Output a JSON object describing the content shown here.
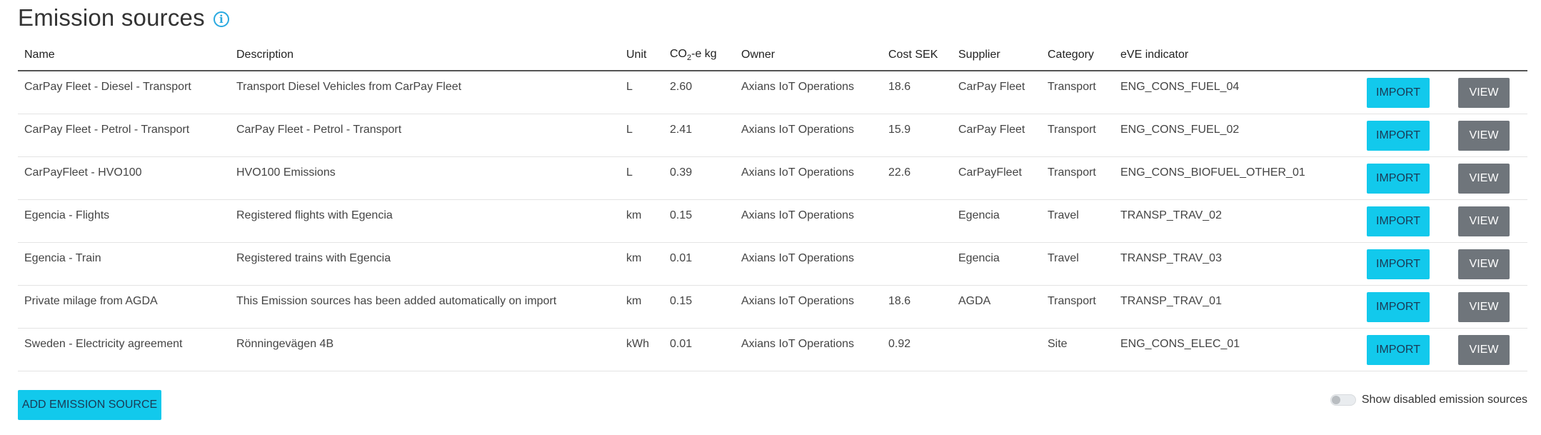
{
  "page": {
    "title": "Emission sources",
    "info_icon": "info-icon"
  },
  "table": {
    "headers": {
      "name": "Name",
      "description": "Description",
      "unit": "Unit",
      "co2_prefix": "CO",
      "co2_sub": "2",
      "co2_suffix": "-e kg",
      "owner": "Owner",
      "cost": "Cost SEK",
      "supplier": "Supplier",
      "category": "Category",
      "indicator": "eVE indicator"
    },
    "rows": [
      {
        "name": "CarPay Fleet - Diesel - Transport",
        "description": "Transport Diesel Vehicles from CarPay Fleet",
        "unit": "L",
        "co2": "2.60",
        "owner": "Axians IoT Operations",
        "cost": "18.6",
        "supplier": "CarPay Fleet",
        "category": "Transport",
        "indicator": "ENG_CONS_FUEL_04",
        "import_label": "IMPORT",
        "view_label": "VIEW"
      },
      {
        "name": "CarPay Fleet - Petrol - Transport",
        "description": "CarPay Fleet - Petrol - Transport",
        "unit": "L",
        "co2": "2.41",
        "owner": "Axians IoT Operations",
        "cost": "15.9",
        "supplier": "CarPay Fleet",
        "category": "Transport",
        "indicator": "ENG_CONS_FUEL_02",
        "import_label": "IMPORT",
        "view_label": "VIEW"
      },
      {
        "name": "CarPayFleet - HVO100",
        "description": "HVO100 Emissions",
        "unit": "L",
        "co2": "0.39",
        "owner": "Axians IoT Operations",
        "cost": "22.6",
        "supplier": "CarPayFleet",
        "category": "Transport",
        "indicator": "ENG_CONS_BIOFUEL_OTHER_01",
        "import_label": "IMPORT",
        "view_label": "VIEW"
      },
      {
        "name": "Egencia - Flights",
        "description": "Registered flights with Egencia",
        "unit": "km",
        "co2": "0.15",
        "owner": "Axians IoT Operations",
        "cost": "",
        "supplier": "Egencia",
        "category": "Travel",
        "indicator": "TRANSP_TRAV_02",
        "import_label": "IMPORT",
        "view_label": "VIEW"
      },
      {
        "name": "Egencia - Train",
        "description": "Registered trains with Egencia",
        "unit": "km",
        "co2": "0.01",
        "owner": "Axians IoT Operations",
        "cost": "",
        "supplier": "Egencia",
        "category": "Travel",
        "indicator": "TRANSP_TRAV_03",
        "import_label": "IMPORT",
        "view_label": "VIEW"
      },
      {
        "name": "Private milage from AGDA",
        "description": "This Emission sources has been added automatically on import",
        "unit": "km",
        "co2": "0.15",
        "owner": "Axians IoT Operations",
        "cost": "18.6",
        "supplier": "AGDA",
        "category": "Transport",
        "indicator": "TRANSP_TRAV_01",
        "import_label": "IMPORT",
        "view_label": "VIEW"
      },
      {
        "name": "Sweden - Electricity agreement",
        "description": "Rönningevägen 4B",
        "unit": "kWh",
        "co2": "0.01",
        "owner": "Axians IoT Operations",
        "cost": "0.92",
        "supplier": "",
        "category": "Site",
        "indicator": "ENG_CONS_ELEC_01",
        "import_label": "IMPORT",
        "view_label": "VIEW"
      }
    ]
  },
  "footer": {
    "add_button_label": "ADD EMISSION SOURCE",
    "toggle_label": "Show disabled emission sources",
    "toggle_on": false
  },
  "colors": {
    "primary_button": "#12c9ec",
    "secondary_button": "#6f757b",
    "info_icon": "#29a9e0"
  }
}
